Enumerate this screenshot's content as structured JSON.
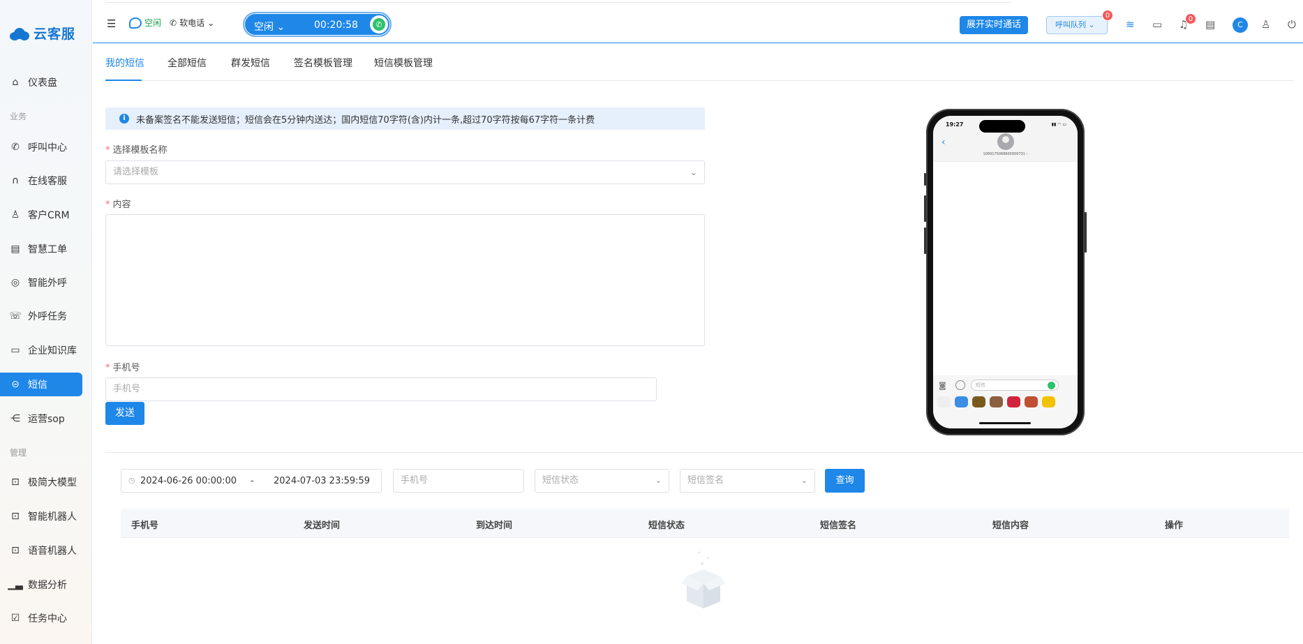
{
  "brand": {
    "name": "云客服"
  },
  "sidebar": {
    "groups": {
      "business": "业务",
      "manage": "管理"
    },
    "items": [
      {
        "label": "仪表盘",
        "icon": "home-icon"
      },
      {
        "label": "呼叫中心",
        "icon": "phone-icon"
      },
      {
        "label": "在线客服",
        "icon": "headset-icon"
      },
      {
        "label": "客户CRM",
        "icon": "user-icon"
      },
      {
        "label": "智慧工单",
        "icon": "document-icon"
      },
      {
        "label": "智能外呼",
        "icon": "whatsapp-icon"
      },
      {
        "label": "外呼任务",
        "icon": "phone-task-icon"
      },
      {
        "label": "企业知识库",
        "icon": "book-icon"
      },
      {
        "label": "短信",
        "icon": "sms-icon",
        "active": true
      },
      {
        "label": "运营sop",
        "icon": "flow-icon"
      },
      {
        "label": "极简大模型",
        "icon": "robot-icon"
      },
      {
        "label": "智能机器人",
        "icon": "robot-icon"
      },
      {
        "label": "语音机器人",
        "icon": "robot-icon"
      },
      {
        "label": "数据分析",
        "icon": "chart-icon"
      },
      {
        "label": "任务中心",
        "icon": "check-icon"
      }
    ]
  },
  "header": {
    "status": "空闲",
    "phone_mode": "软电话",
    "call_state": "空闲",
    "timer": "00:20:58",
    "expand_label": "展开实时通话",
    "queue_label": "呼叫队列",
    "queue_badge": "0",
    "notify_badge": "0",
    "avatar_letter": "C"
  },
  "tabs": [
    "我的短信",
    "全部短信",
    "群发短信",
    "签名模板管理",
    "短信模板管理"
  ],
  "form": {
    "notice": "未备案签名不能发送短信；短信会在5分钟内送达；国内短信70字符(含)内计一条,超过70字符按每67字符一条计费",
    "template_label": "选择模板名称",
    "template_placeholder": "请选择模板",
    "content_label": "内容",
    "phone_label": "手机号",
    "phone_placeholder": "手机号",
    "send_label": "发送"
  },
  "phone_preview": {
    "time": "19:27",
    "sender": "1069175068900000731 ›",
    "message_placeholder": "短信"
  },
  "search": {
    "date_start": "2024-06-26 00:00:00",
    "date_sep": "-",
    "date_end": "2024-07-03 23:59:59",
    "phone_placeholder": "手机号",
    "status_placeholder": "短信状态",
    "sign_placeholder": "短信签名",
    "query_label": "查询"
  },
  "table": {
    "columns": [
      "手机号",
      "发送时间",
      "到达时间",
      "短信状态",
      "短信签名",
      "短信内容",
      "操作"
    ]
  },
  "colors": {
    "accent": "#1e87e8",
    "success": "#2dc26b",
    "danger": "#f55a5a"
  }
}
